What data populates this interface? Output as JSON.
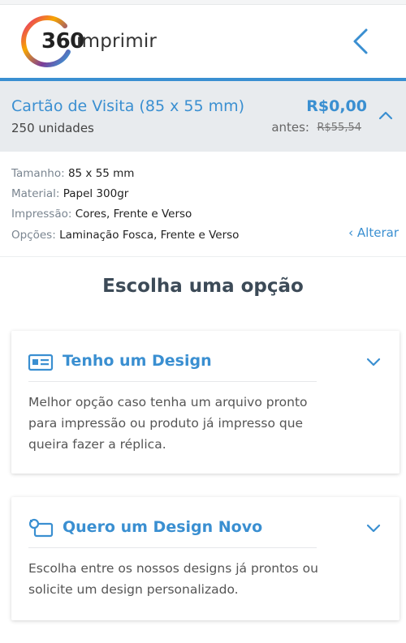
{
  "brand": {
    "number": "360",
    "word": "imprimir",
    "colors": [
      "#e6217a",
      "#f7a600",
      "#7d3c98",
      "#2ea6df"
    ]
  },
  "header": {
    "back_icon": "chevron-left-icon"
  },
  "summary": {
    "title": "Cartão de Visita (85 x 55 mm)",
    "quantity": "250 unidades",
    "price": "R$0,00",
    "before_label": "antes:",
    "before_price": "R$55,54"
  },
  "specs": [
    {
      "label": "Tamanho:",
      "value": "85 x 55 mm"
    },
    {
      "label": "Material:",
      "value": "Papel 300gr"
    },
    {
      "label": "Impressão:",
      "value": "Cores, Frente e Verso"
    },
    {
      "label": "Opções:",
      "value": "Laminação Fosca, Frente e Verso"
    }
  ],
  "change_link": "‹ Alterar",
  "choose_title": "Escolha uma opção",
  "options": [
    {
      "title": "Tenho um Design",
      "icon": "id-card-icon",
      "description": "Melhor opção caso tenha um arquivo pronto para impressão ou produto já impresso que queira fazer a réplica."
    },
    {
      "title": "Quero um Design Novo",
      "icon": "design-tool-icon",
      "description": "Escolha entre os nossos designs já prontos ou solicite um design personalizado."
    }
  ],
  "accent_color": "#3a8fd1"
}
